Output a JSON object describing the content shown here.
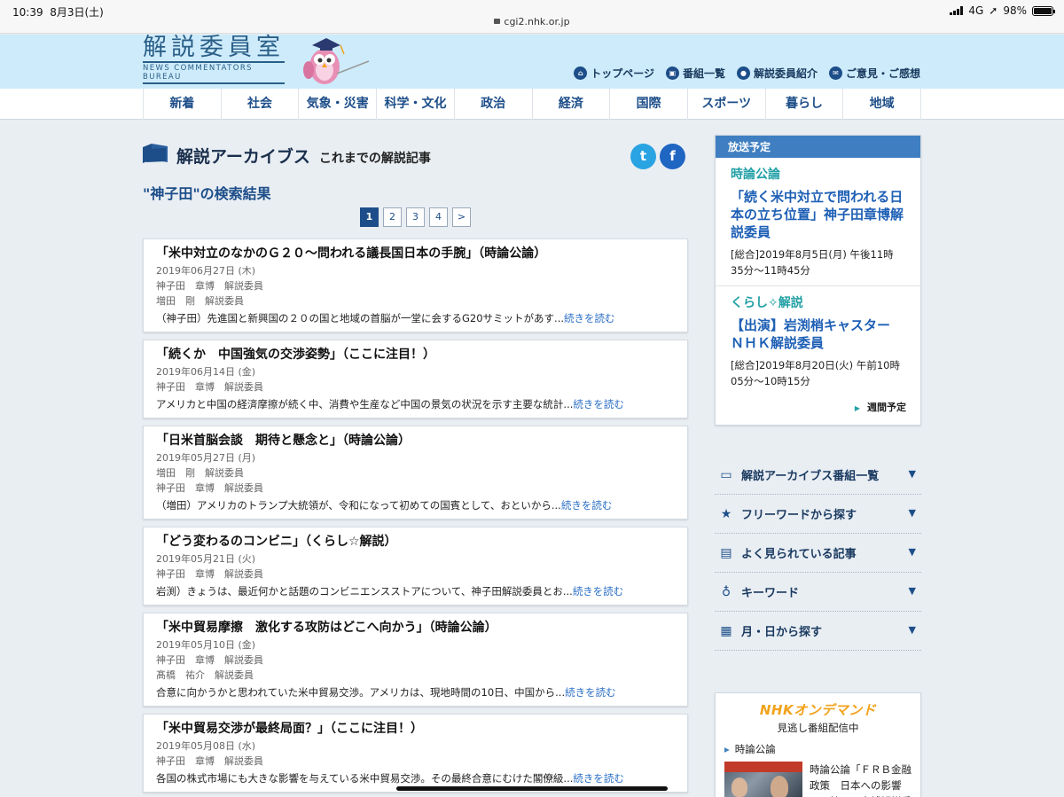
{
  "status_bar": {
    "time": "10:39",
    "date": "8月3日(土)",
    "url": "cgi2.nhk.or.jp",
    "network": "4G",
    "battery": "98%",
    "battery_level": 0.98
  },
  "header": {
    "logo_title": "解説委員室",
    "logo_subtitle": "NEWS COMMENTATORS BUREAU",
    "links": [
      {
        "icon": "home-icon",
        "label": "トップページ"
      },
      {
        "icon": "tv-icon",
        "label": "番組一覧"
      },
      {
        "icon": "person-icon",
        "label": "解説委員紹介"
      },
      {
        "icon": "mail-icon",
        "label": "ご意見・ご感想"
      }
    ]
  },
  "nav": [
    "新着",
    "社会",
    "気象・災害",
    "科学・文化",
    "政治",
    "経済",
    "国際",
    "スポーツ",
    "暮らし",
    "地域"
  ],
  "main": {
    "title": "解説アーカイブス",
    "subtitle": "これまでの解説記事",
    "search_title": "\"神子田\"の検索結果",
    "pages": [
      "1",
      "2",
      "3",
      "4",
      ">"
    ],
    "current_page": "1",
    "articles": [
      {
        "title": "「米中対立のなかのＧ２０～問われる議長国日本の手腕」（時論公論）",
        "date": "2019年06月27日 (木)",
        "authors": [
          "神子田　章博　解説委員",
          "増田　剛　解説委員"
        ],
        "excerpt": "（神子田）先進国と新興国の２０の国と地域の首脳が一堂に会するG20サミットがあす...",
        "read_more": "続きを読む"
      },
      {
        "title": "「続くか　中国強気の交渉姿勢」（ここに注目！）",
        "date": "2019年06月14日 (金)",
        "authors": [
          "神子田　章博　解説委員"
        ],
        "excerpt": "アメリカと中国の経済摩擦が続く中、消費や生産など中国の景気の状況を示す主要な統計...",
        "read_more": "続きを読む"
      },
      {
        "title": "「日米首脳会談　期待と懸念と」（時論公論）",
        "date": "2019年05月27日 (月)",
        "authors": [
          "増田　剛　解説委員",
          "神子田　章博　解説委員"
        ],
        "excerpt": "（増田）アメリカのトランプ大統領が、令和になって初めての国賓として、おといから...",
        "read_more": "続きを読む"
      },
      {
        "title": "「どう変わるのコンビニ」（くらし☆解説）",
        "date": "2019年05月21日 (火)",
        "authors": [
          "神子田　章博　解説委員"
        ],
        "excerpt": "岩渕）きょうは、最近何かと話題のコンビニエンスストアについて、神子田解説委員とお...",
        "read_more": "続きを読む"
      },
      {
        "title": "「米中貿易摩擦　激化する攻防はどこへ向かう」（時論公論）",
        "date": "2019年05月10日 (金)",
        "authors": [
          "神子田　章博　解説委員",
          "髙橋　祐介　解説委員"
        ],
        "excerpt": "合意に向かうかと思われていた米中貿易交渉。アメリカは、現地時間の10日、中国から...",
        "read_more": "続きを読む"
      },
      {
        "title": "「米中貿易交渉が最終局面？」（ここに注目！）",
        "date": "2019年05月08日 (水)",
        "authors": [
          "神子田　章博　解説委員"
        ],
        "excerpt": "各国の株式市場にも大きな影響を与えている米中貿易交渉。その最終合意にむけた閣僚級...",
        "read_more": "続きを読む"
      }
    ]
  },
  "sidebar": {
    "schedule_header": "放送予定",
    "programs": [
      {
        "name": "時論公論",
        "title": "「続く米中対立で問われる日本の立ち位置」神子田章博解説委員",
        "time": "[総合]2019年8月5日(月) 午後11時35分～11時45分"
      },
      {
        "name": "くらし✧解説",
        "title": "【出演】岩渕梢キャスター　ＮＨＫ解説委員",
        "time": "[総合]2019年8月20日(火) 午前10時05分～10時15分"
      }
    ],
    "weekly_link": "週間予定",
    "menu": [
      {
        "icon": "monitor-icon",
        "label": "解説アーカイブス番組一覧"
      },
      {
        "icon": "star-icon",
        "label": "フリーワードから探す"
      },
      {
        "icon": "document-icon",
        "label": "よく見られている記事"
      },
      {
        "icon": "lightbulb-icon",
        "label": "キーワード"
      },
      {
        "icon": "calendar-icon",
        "label": "月・日から探す"
      }
    ],
    "ondemand": {
      "logo": "NHKオンデマンド",
      "subtitle": "見逃し番組配信中",
      "category": "時論公論",
      "item_text": "時論公論「ＦＲＢ金融政策　日本への影響は」神子田章博解説委員"
    }
  }
}
